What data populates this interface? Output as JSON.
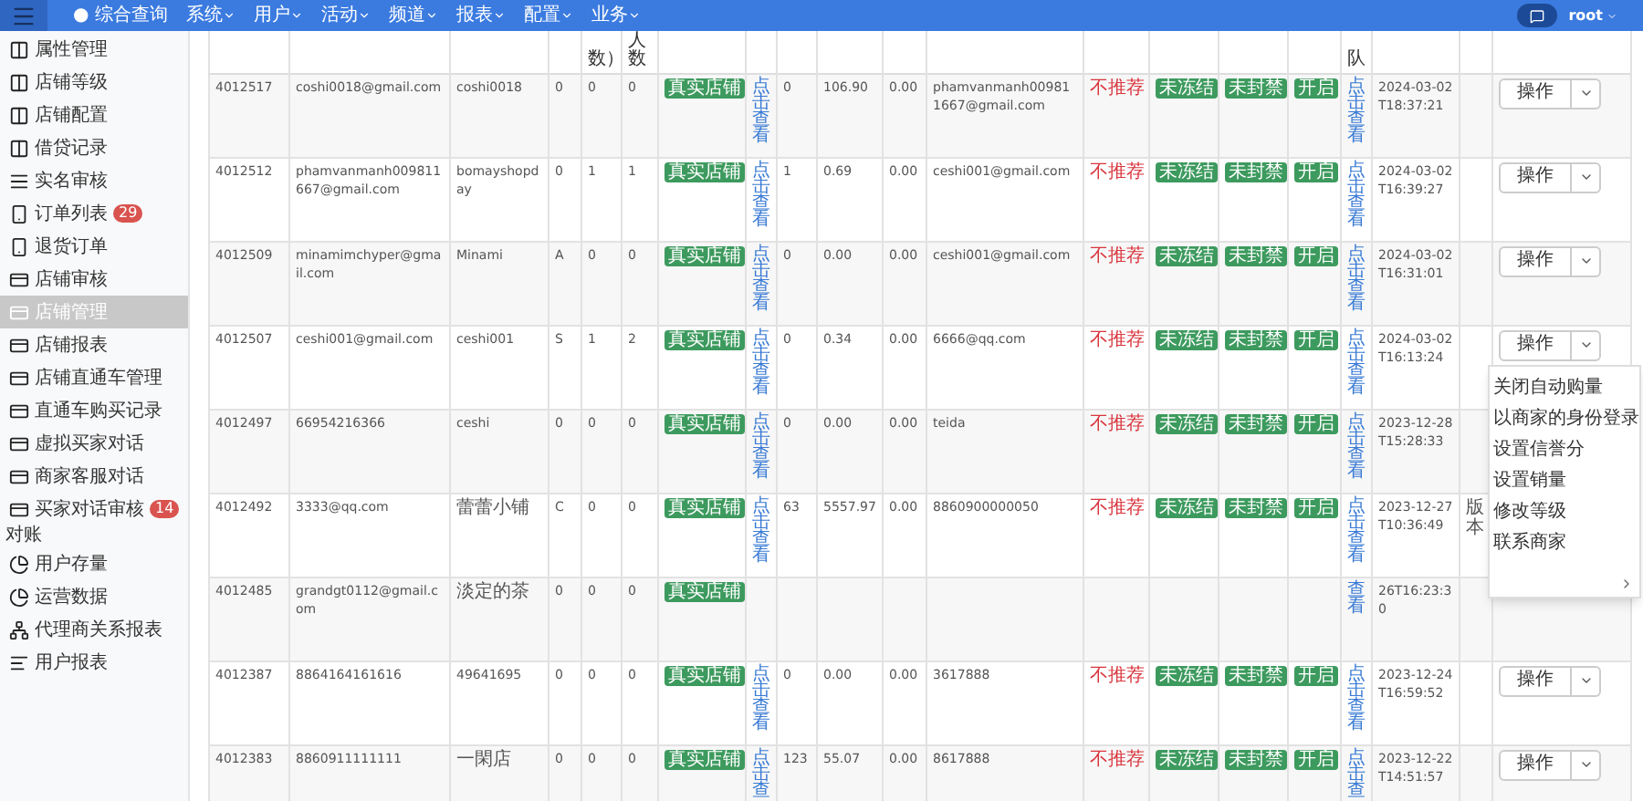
{
  "top_bar": {
    "nav": [
      {
        "label": "● 综合查询",
        "dropdown": false
      },
      {
        "label": "系统",
        "dropdown": true
      },
      {
        "label": "用户",
        "dropdown": true
      },
      {
        "label": "活动",
        "dropdown": true
      },
      {
        "label": "频道",
        "dropdown": true
      },
      {
        "label": "报表",
        "dropdown": true
      },
      {
        "label": "配置",
        "dropdown": true
      },
      {
        "label": "业务",
        "dropdown": true
      }
    ],
    "user": "root"
  },
  "sidebar": {
    "items": [
      {
        "kind": "columns",
        "label": "属性管理",
        "selected": false
      },
      {
        "kind": "columns",
        "label": "店铺等级",
        "selected": false
      },
      {
        "kind": "columns",
        "label": "店铺配置",
        "selected": false
      },
      {
        "kind": "columns",
        "label": "借贷记录",
        "selected": false
      },
      {
        "kind": "list",
        "label": "实名审核",
        "selected": false
      },
      {
        "kind": "phone",
        "label": "订单列表",
        "selected": false,
        "badge": "29"
      },
      {
        "kind": "phone",
        "label": "退货订单",
        "selected": false
      },
      {
        "kind": "card",
        "label": "店铺审核",
        "selected": false
      },
      {
        "kind": "card",
        "label": "店铺管理",
        "selected": true
      },
      {
        "kind": "card",
        "label": "店铺报表",
        "selected": false
      },
      {
        "kind": "card",
        "label": "店铺直通车管理",
        "selected": false
      },
      {
        "kind": "card",
        "label": "直通车购买记录",
        "selected": false
      },
      {
        "kind": "card",
        "label": "虚拟买家对话",
        "selected": false
      },
      {
        "kind": "card",
        "label": "商家客服对话",
        "selected": false
      },
      {
        "kind": "card",
        "label": "买家对话审核",
        "selected": false,
        "badge": "14"
      },
      {
        "kind": "section",
        "label": "对账"
      },
      {
        "kind": "pie",
        "label": "用户存量",
        "selected": false
      },
      {
        "kind": "pie",
        "label": "运营数据",
        "selected": false
      },
      {
        "kind": "tree",
        "label": "代理商关系报表",
        "selected": false
      },
      {
        "kind": "lines",
        "label": "用户报表",
        "selected": false
      }
    ]
  },
  "table": {
    "header": {
      "count_a": "数）",
      "count_b": "人数",
      "link2": "队"
    },
    "rows": [
      {
        "id": "4012517",
        "email": "coshi0018@gmail.com",
        "name": "coshi0018",
        "level": "0",
        "count_a": "0",
        "count_b": "0",
        "shop_type": "真实店铺",
        "link": "点击查看",
        "num": "0",
        "amount": "106.90",
        "zero": "0.00",
        "email2": "phamvanmanh009811667@gmail.com",
        "recommend": "不推荐",
        "freeze": "未冻结",
        "ban": "未封禁",
        "switch": "开启",
        "link2": "点击查看",
        "date": "2024-03-02T18:37:21",
        "action": "操作"
      },
      {
        "id": "4012512",
        "email": "phamvanmanh009811667@gmail.com",
        "name": "bomayshopday",
        "level": "0",
        "count_a": "1",
        "count_b": "1",
        "shop_type": "真实店铺",
        "link": "点击查看",
        "num": "1",
        "amount": "0.69",
        "zero": "0.00",
        "email2": "ceshi001@gmail.com",
        "recommend": "不推荐",
        "freeze": "未冻结",
        "ban": "未封禁",
        "switch": "开启",
        "link2": "点击查看",
        "date": "2024-03-02T16:39:27",
        "action": "操作"
      },
      {
        "id": "4012509",
        "email": "minamimchyper@gmail.com",
        "name": "Minami",
        "level": "A",
        "count_a": "0",
        "count_b": "0",
        "shop_type": "真实店铺",
        "link": "点击查看",
        "num": "0",
        "amount": "0.00",
        "zero": "0.00",
        "email2": "ceshi001@gmail.com",
        "recommend": "不推荐",
        "freeze": "未冻结",
        "ban": "未封禁",
        "switch": "开启",
        "link2": "点击查看",
        "date": "2024-03-02T16:31:01",
        "action": "操作"
      },
      {
        "id": "4012507",
        "email": "ceshi001@gmail.com",
        "name": "ceshi001",
        "level": "S",
        "count_a": "1",
        "count_b": "2",
        "shop_type": "真实店铺",
        "link": "点击查看",
        "num": "0",
        "amount": "0.34",
        "zero": "0.00",
        "email2": "6666@qq.com",
        "recommend": "不推荐",
        "freeze": "未冻结",
        "ban": "未封禁",
        "switch": "开启",
        "link2": "点击查看",
        "date": "2024-03-02T16:13:24",
        "action": "操作"
      },
      {
        "id": "4012497",
        "email": "66954216366",
        "name": "ceshi",
        "level": "0",
        "count_a": "0",
        "count_b": "0",
        "shop_type": "真实店铺",
        "link": "点击查看",
        "num": "0",
        "amount": "0.00",
        "zero": "0.00",
        "email2": "teida",
        "recommend": "不推荐",
        "freeze": "未冻结",
        "ban": "未封禁",
        "switch": "开启",
        "link2": "点击查看",
        "date": "2023-12-28T15:28:33"
      },
      {
        "id": "4012492",
        "email": "3333@qq.com",
        "name": "蕾蕾小铺",
        "level": "C",
        "count_a": "0",
        "count_b": "0",
        "shop_type": "真实店铺",
        "link": "点击查看",
        "num": "63",
        "amount": "5557.97",
        "zero": "0.00",
        "email2": "8860900000050",
        "recommend": "不推荐",
        "freeze": "未冻结",
        "ban": "未封禁",
        "switch": "开启",
        "link2": "点击查看",
        "date": "2023-12-27T10:36:49",
        "extra": "版本"
      },
      {
        "id": "4012485",
        "email": "grandgt0112@gmail.com",
        "name": "淡定的茶",
        "level": "0",
        "count_a": "0",
        "count_b": "0",
        "shop_type": "真实店铺",
        "link2": "查看",
        "date": "26T16:23:30"
      },
      {
        "id": "4012387",
        "email": "8864164161616",
        "name": "49641695",
        "level": "0",
        "count_a": "0",
        "count_b": "0",
        "shop_type": "真实店铺",
        "link": "点击查看",
        "num": "0",
        "amount": "0.00",
        "zero": "0.00",
        "email2": "3617888",
        "recommend": "不推荐",
        "freeze": "未冻结",
        "ban": "未封禁",
        "switch": "开启",
        "link2": "点击查看",
        "date": "2023-12-24T16:59:52",
        "action": "操作"
      },
      {
        "id": "4012383",
        "email": "8860911111111",
        "name": "一閑店",
        "level": "0",
        "count_a": "0",
        "count_b": "0",
        "shop_type": "真实店铺",
        "link": "点击查",
        "num": "123",
        "amount": "55.07",
        "zero": "0.00",
        "email2": "8617888",
        "recommend": "不推荐",
        "freeze": "未冻结",
        "ban": "未封禁",
        "switch": "开启",
        "link2": "点击查",
        "date": "2023-12-22T14:51:57",
        "action": "操作"
      }
    ]
  },
  "action_menu": {
    "items": [
      "关闭自动购量",
      "以商家的身份登录",
      "设置信誉分",
      "设置销量",
      "修改等级",
      "联系商家"
    ]
  }
}
